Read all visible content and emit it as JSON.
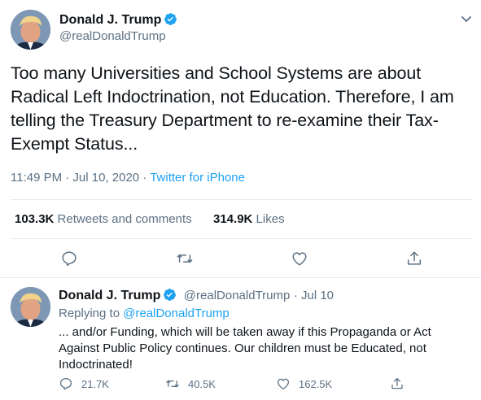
{
  "main_tweet": {
    "author_name": "Donald J. Trump",
    "author_handle": "@realDonaldTrump",
    "text": "Too many Universities and School Systems are about Radical Left Indoctrination, not Education. Therefore, I am telling the Treasury Department to re-examine their Tax-Exempt Status...",
    "time": "11:49 PM · Jul 10, 2020 · ",
    "source": "Twitter for iPhone",
    "retweets_count": "103.3K",
    "retweets_label": "Retweets and comments",
    "likes_count": "314.9K",
    "likes_label": "Likes"
  },
  "reply_tweet": {
    "author_name": "Donald J. Trump",
    "author_handle": "@realDonaldTrump",
    "date": "· Jul 10",
    "replying_prefix": "Replying to",
    "replying_to": "@realDonaldTrump",
    "text": "... and/or Funding, which will be taken away if this Propaganda or Act Against Public Policy continues. Our children must be Educated, not Indoctrinated!",
    "reply_count": "21.7K",
    "retweet_count": "40.5K",
    "like_count": "162.5K"
  },
  "colors": {
    "accent": "#1da1f2",
    "secondary_text": "#5b7083",
    "divider": "#e6ecf0"
  },
  "icons": [
    "verified-badge-icon",
    "chevron-down-icon",
    "reply-icon",
    "retweet-icon",
    "like-icon",
    "share-icon"
  ]
}
